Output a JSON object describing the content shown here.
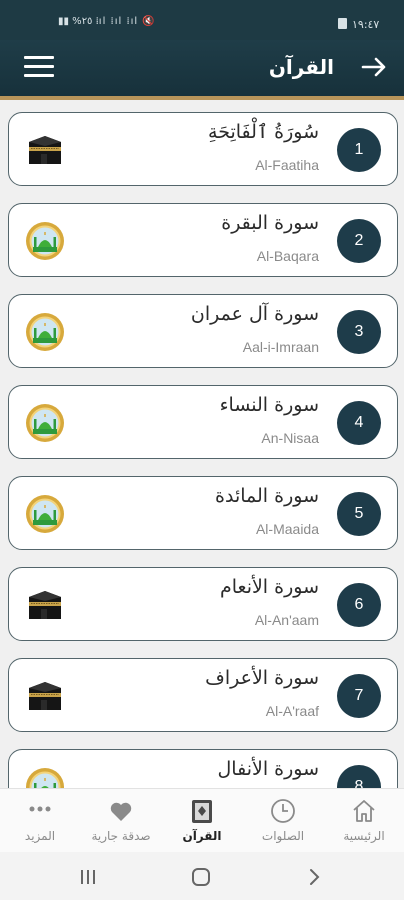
{
  "status_bar": {
    "time": "١٩:٤٧",
    "indicators": "▮▮ %٢٥ ⁞ıl ⁞ıl ⁞ıl 🔇"
  },
  "header": {
    "title": "القرآن"
  },
  "surahs": [
    {
      "number": "1",
      "arabic": "سُورَةُ ٱلْفَاتِحَةِ",
      "english": "Al-Faatiha",
      "icon": "kaaba-icon"
    },
    {
      "number": "2",
      "arabic": "سورة البقرة",
      "english": "Al-Baqara",
      "icon": "mosque-icon"
    },
    {
      "number": "3",
      "arabic": "سورة آل عمران",
      "english": "Aal-i-Imraan",
      "icon": "mosque-icon"
    },
    {
      "number": "4",
      "arabic": "سورة النساء",
      "english": "An-Nisaa",
      "icon": "mosque-icon"
    },
    {
      "number": "5",
      "arabic": "سورة المائدة",
      "english": "Al-Maaida",
      "icon": "mosque-icon"
    },
    {
      "number": "6",
      "arabic": "سورة الأنعام",
      "english": "Al-An'aam",
      "icon": "kaaba-icon"
    },
    {
      "number": "7",
      "arabic": "سورة الأعراف",
      "english": "Al-A'raaf",
      "icon": "kaaba-icon"
    },
    {
      "number": "8",
      "arabic": "سورة الأنفال",
      "english": "",
      "icon": "mosque-icon"
    }
  ],
  "bottom_nav": [
    {
      "label": "الرئيسية",
      "icon": "home-icon"
    },
    {
      "label": "الصلوات",
      "icon": "clock-icon"
    },
    {
      "label": "القرآن",
      "icon": "quran-icon",
      "active": true
    },
    {
      "label": "صدقة جارية",
      "icon": "heart-icon"
    },
    {
      "label": "المزيد",
      "icon": "more-icon"
    }
  ],
  "colors": {
    "header": "#1e3a44",
    "accent": "#b8955a",
    "badge": "#1e3c4a"
  }
}
